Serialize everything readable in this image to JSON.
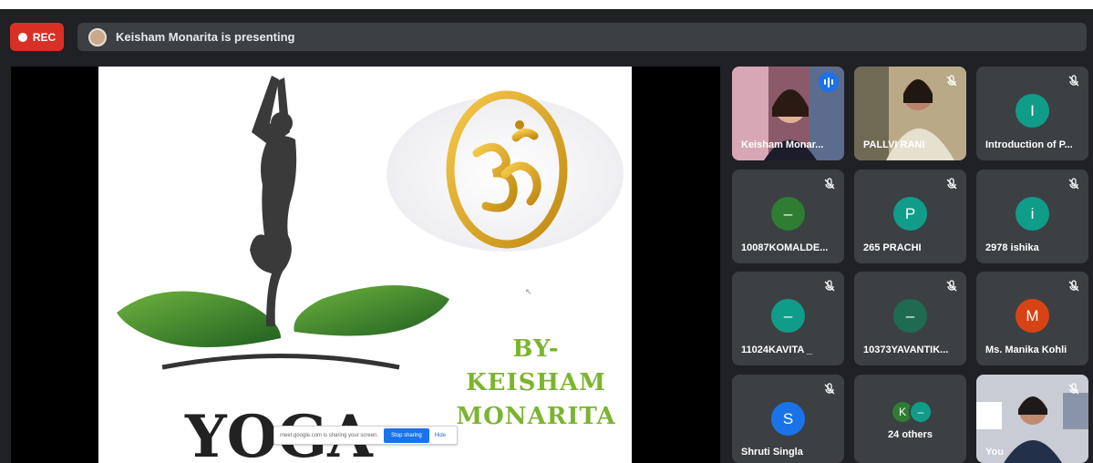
{
  "recording": {
    "label": "REC"
  },
  "presenter_bar": {
    "text": "Keisham Monarita is presenting"
  },
  "slide": {
    "logo_word": "YOGA",
    "byline_1": "BY-",
    "byline_2": "KEISHAM",
    "byline_3": "MONARITA"
  },
  "share_banner": {
    "message": "meet.google.com is sharing your screen.",
    "stop_label": "Stop sharing",
    "hide_label": "Hide"
  },
  "participants": [
    {
      "name": "Keisham Monar...",
      "type": "video",
      "speaking": true
    },
    {
      "name": "PALLVI RANI",
      "type": "video",
      "muted": true
    },
    {
      "name": "Introduction of P...",
      "initial": "I",
      "color": "#0f9d8a",
      "muted": true
    },
    {
      "name": "10087KOMALDE...",
      "initial": "–",
      "color": "#2e7d32",
      "muted": true
    },
    {
      "name": "265 PRACHI",
      "initial": "P",
      "color": "#0f9d8a",
      "muted": true
    },
    {
      "name": "2978 ishika",
      "initial": "i",
      "color": "#0f9d8a",
      "muted": true
    },
    {
      "name": "11024KAVITA _",
      "initial": "–",
      "color": "#0f9d8a",
      "muted": true
    },
    {
      "name": "10373YAVANTIK...",
      "initial": "–",
      "color": "#1e6b52",
      "muted": true
    },
    {
      "name": "Ms. Manika Kohli",
      "initial": "M",
      "color": "#d84315",
      "muted": true
    },
    {
      "name": "Shruti Singla",
      "initial": "S",
      "color": "#1a73e8",
      "muted": true
    }
  ],
  "others": {
    "label": "24 others",
    "initial_a": "K",
    "initial_b": "–",
    "color_a": "#2e7d32",
    "color_b": "#0f9d8a"
  },
  "self_tile": {
    "name": "You"
  }
}
